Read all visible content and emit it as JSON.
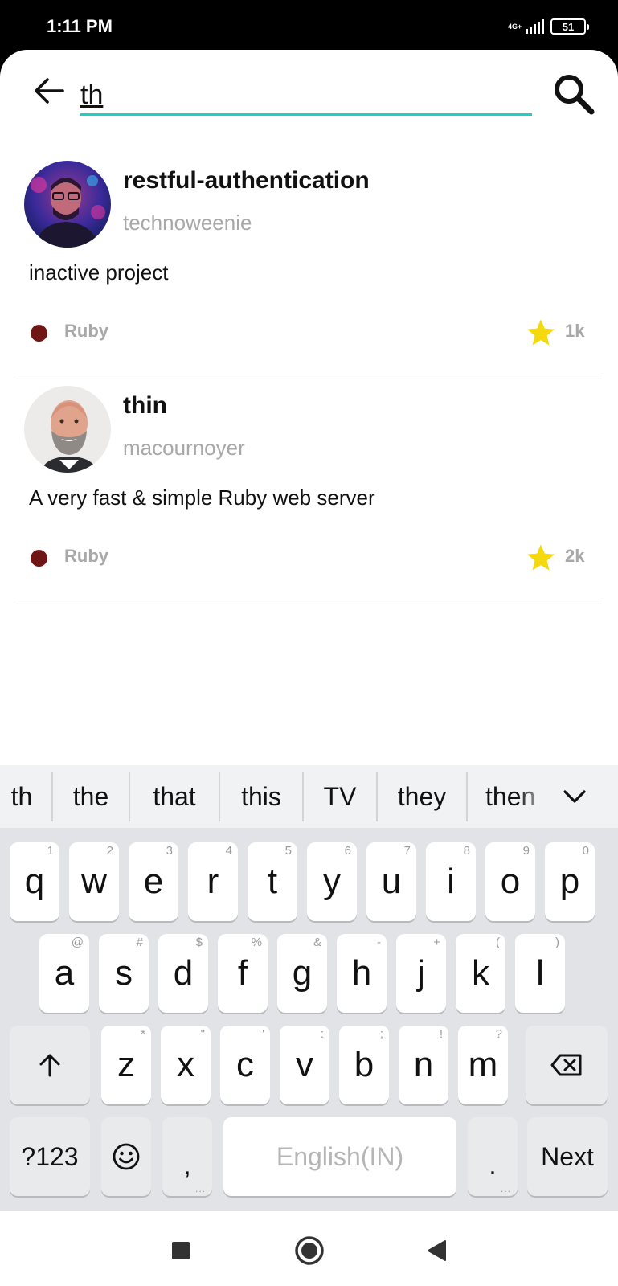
{
  "status_bar": {
    "time": "1:11 PM",
    "network": "4G+",
    "battery": "51",
    "battery_level_percent": 51
  },
  "search": {
    "query": "th",
    "back_icon": "arrow-left-icon",
    "search_icon": "search-icon",
    "accent_color": "#1fcfc1"
  },
  "results": [
    {
      "name": "restful-authentication",
      "owner": "technoweenie",
      "description": "inactive project",
      "language": "Ruby",
      "language_color": "#701516",
      "stars": "1k"
    },
    {
      "name": "thin",
      "owner": "macournoyer",
      "description": "A very fast & simple Ruby web server",
      "language": "Ruby",
      "language_color": "#701516",
      "stars": "2k"
    }
  ],
  "keyboard": {
    "suggestions": [
      "th",
      "the",
      "that",
      "this",
      "TV",
      "they",
      "then"
    ],
    "row1": [
      {
        "key": "q",
        "hint": "1"
      },
      {
        "key": "w",
        "hint": "2"
      },
      {
        "key": "e",
        "hint": "3"
      },
      {
        "key": "r",
        "hint": "4"
      },
      {
        "key": "t",
        "hint": "5"
      },
      {
        "key": "y",
        "hint": "6"
      },
      {
        "key": "u",
        "hint": "7"
      },
      {
        "key": "i",
        "hint": "8"
      },
      {
        "key": "o",
        "hint": "9"
      },
      {
        "key": "p",
        "hint": "0"
      }
    ],
    "row2": [
      {
        "key": "a",
        "hint": "@"
      },
      {
        "key": "s",
        "hint": "#"
      },
      {
        "key": "d",
        "hint": "$"
      },
      {
        "key": "f",
        "hint": "%"
      },
      {
        "key": "g",
        "hint": "&"
      },
      {
        "key": "h",
        "hint": "-"
      },
      {
        "key": "j",
        "hint": "+"
      },
      {
        "key": "k",
        "hint": "("
      },
      {
        "key": "l",
        "hint": ")"
      }
    ],
    "row3": [
      {
        "key": "z",
        "hint": "*"
      },
      {
        "key": "x",
        "hint": "\""
      },
      {
        "key": "c",
        "hint": "'"
      },
      {
        "key": "v",
        "hint": ":"
      },
      {
        "key": "b",
        "hint": ";"
      },
      {
        "key": "n",
        "hint": "!"
      },
      {
        "key": "m",
        "hint": "?"
      }
    ],
    "symbols_label": "?123",
    "comma": ",",
    "space_label": "English(IN)",
    "period": ".",
    "action_label": "Next"
  },
  "nav": {
    "recents_icon": "square-icon",
    "home_icon": "circle-icon",
    "back_icon": "triangle-back-icon"
  }
}
